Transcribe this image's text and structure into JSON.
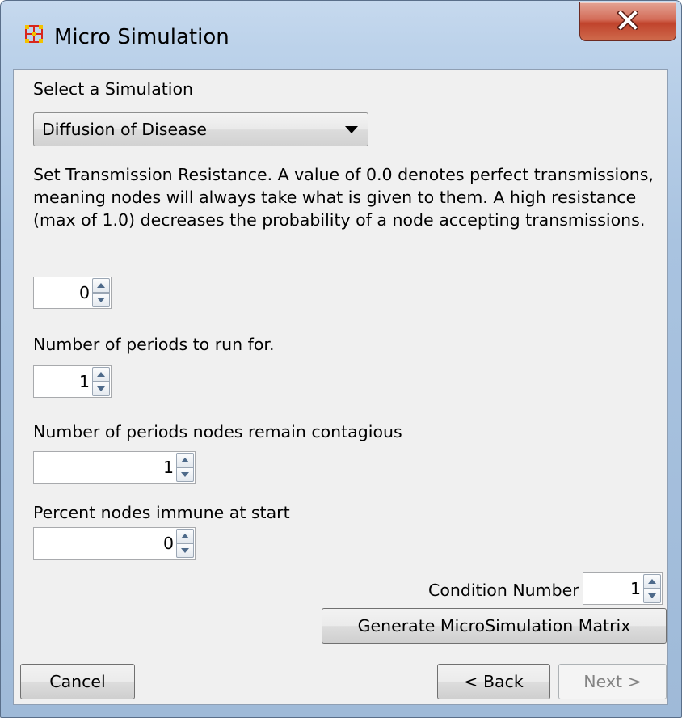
{
  "window": {
    "title": "Micro Simulation",
    "icon": "network-grid-icon",
    "accent_color": "#c8302a"
  },
  "simulation": {
    "select_label": "Select a Simulation",
    "selected": "Diffusion of Disease"
  },
  "transmission": {
    "description": "Set Transmission Resistance. A value of 0.0 denotes perfect transmissions, meaning nodes will always take what is given to them. A high resistance (max of 1.0) decreases the probability of a node accepting transmissions.",
    "value": "0"
  },
  "periods": {
    "label": "Number of periods to run for.",
    "value": "1"
  },
  "contagious": {
    "label": "Number of periods nodes remain contagious",
    "value": "1"
  },
  "immune": {
    "label": "Percent nodes immune at start",
    "value": "0"
  },
  "condition": {
    "label": "Condition Number",
    "value": "1"
  },
  "buttons": {
    "generate": "Generate MicroSimulation Matrix",
    "cancel": "Cancel",
    "back": "< Back",
    "next": "Next >"
  }
}
